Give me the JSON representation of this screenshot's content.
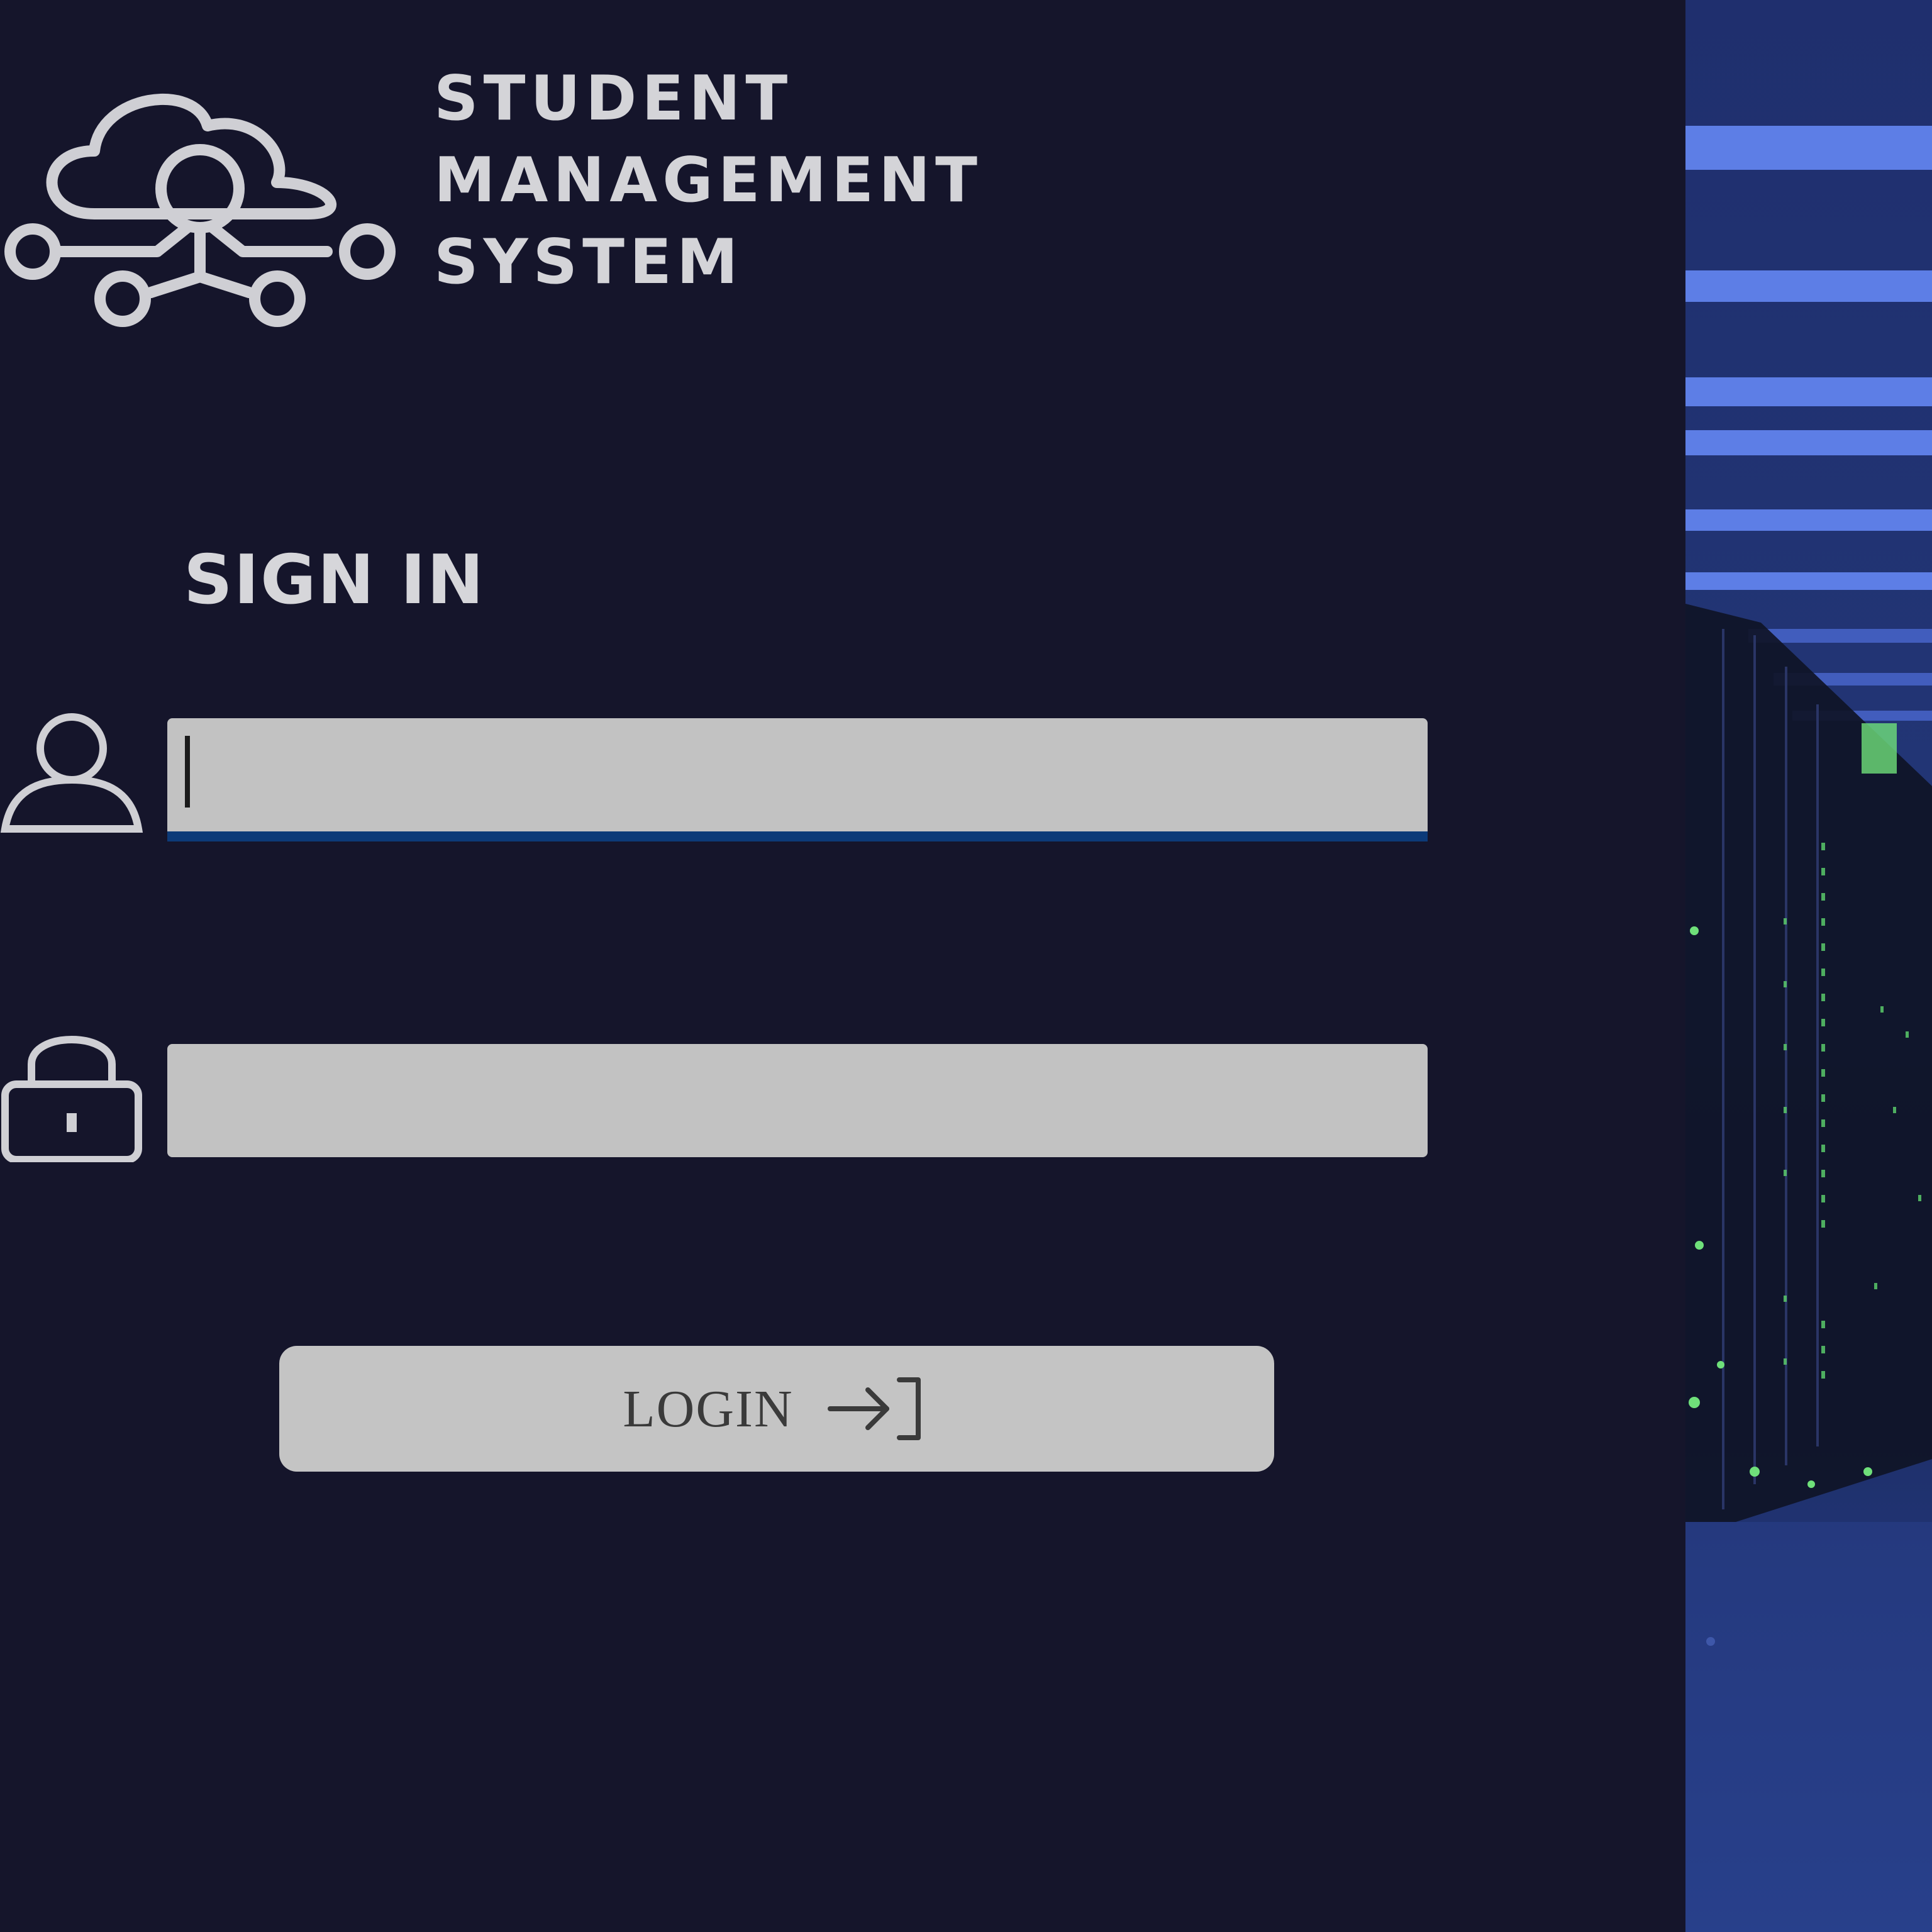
{
  "brand": {
    "line1": "STUDENT",
    "line2": "MANAGEMENT",
    "line3": "SYSTEM"
  },
  "form": {
    "title": "SIGN IN",
    "username": {
      "value": "",
      "placeholder": ""
    },
    "password": {
      "value": "",
      "placeholder": ""
    },
    "login_label": "LOGIN"
  },
  "icons": {
    "logo": "cloud-network-icon",
    "username": "user-icon",
    "password": "lock-icon",
    "login": "login-arrow-icon"
  },
  "colors": {
    "background": "#15152b",
    "input_fill": "#c2c2c2",
    "focus_underline": "#0c3a78",
    "text_light": "#d4d4d8",
    "side_accent": "#3b5bd0"
  }
}
